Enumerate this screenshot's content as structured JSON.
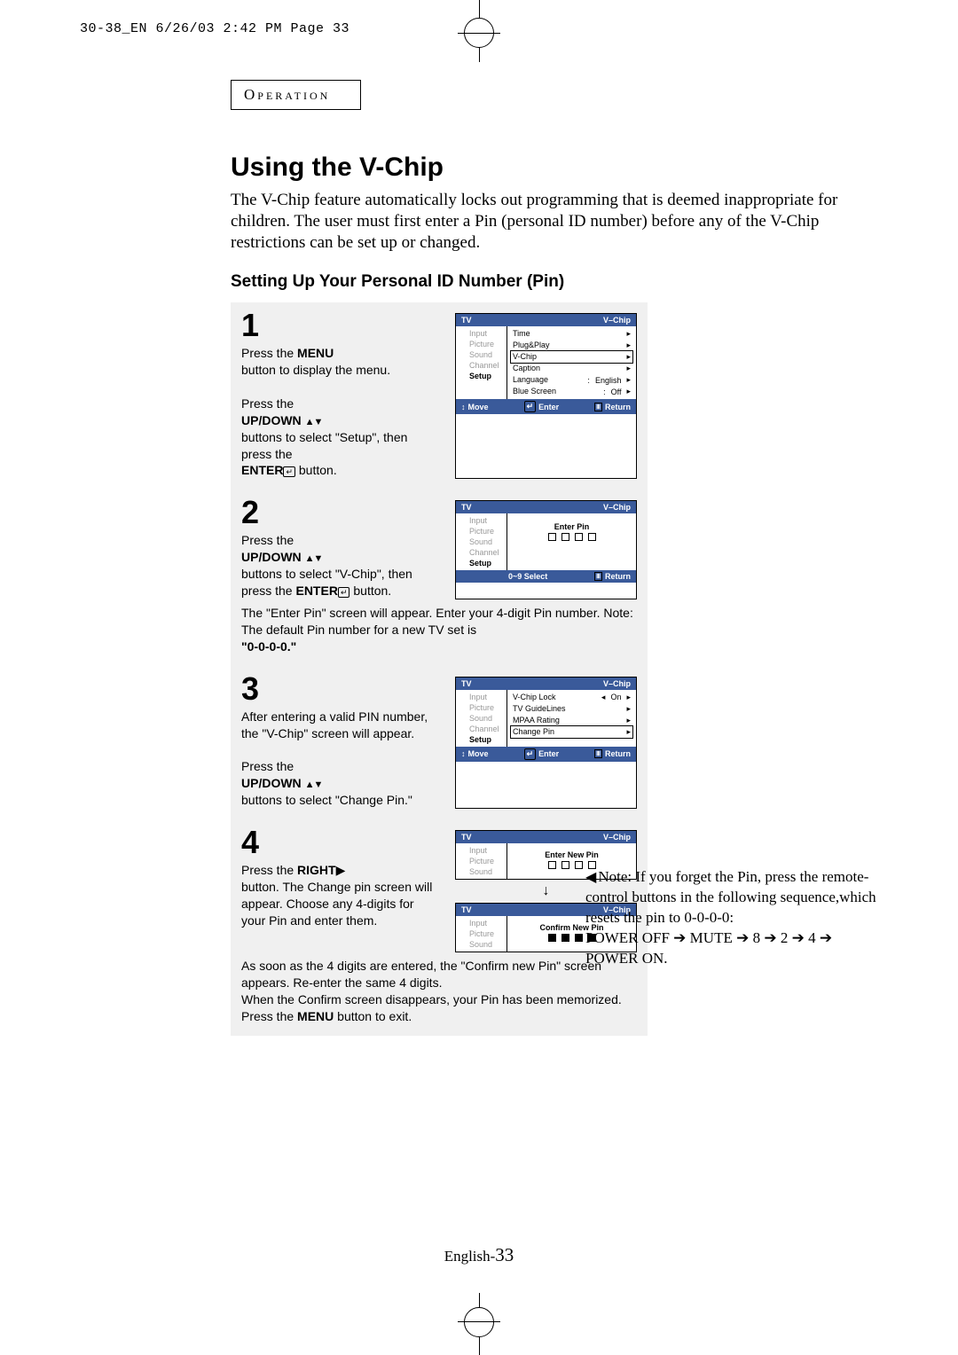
{
  "header_stamp": "30-38_EN  6/26/03 2:42 PM  Page 33",
  "section_label": "Operation",
  "title": "Using the V-Chip",
  "intro": "The V-Chip feature automatically locks out programming that is deemed inappropriate for children. The user must first enter a Pin (personal ID number) before any of the V-Chip restrictions can be set up or changed.",
  "subhead": "Setting Up Your Personal ID Number (Pin)",
  "step1": {
    "num": "1",
    "l1": "Press the ",
    "l1b": "MENU",
    "l2": "button to display the menu.",
    "l3": "Press the",
    "l3b": "UP/DOWN",
    "l4": "buttons to select \"Setup\", then press the",
    "l4b": "ENTER",
    "l5": "  button."
  },
  "step2": {
    "num": "2",
    "l1": "Press the",
    "l1b": "UP/DOWN",
    "l2": "buttons to select \"V-Chip\", then press the ",
    "l2b": "ENTER",
    "l3": "  button.",
    "post": "The \"Enter Pin\" screen will appear. Enter your 4-digit Pin number. Note: The default Pin number for a new TV set is",
    "postb": "\"0-0-0-0.\""
  },
  "step3": {
    "num": "3",
    "l1": "After entering a valid PIN number, the \"V-Chip\" screen will appear.",
    "l2": "Press the",
    "l2b": "UP/DOWN",
    "l3": "buttons to select \"Change Pin.\""
  },
  "step4": {
    "num": "4",
    "l1": "Press the ",
    "l1b": "RIGHT",
    "l2": "button. The Change pin screen will appear. Choose any 4-digits for your Pin and enter them.",
    "post1": "As soon as the 4 digits are entered, the \"Confirm new Pin\" screen appears. Re-enter the same 4 digits.",
    "post2": "When the Confirm screen disappears, your Pin has been memorized.",
    "post3_a": "Press the ",
    "post3_b": "MENU",
    "post3_c": " button to exit."
  },
  "osd_common": {
    "tv": "TV",
    "vchip": "V–Chip",
    "side_input": "Input",
    "side_picture": "Picture",
    "side_sound": "Sound",
    "side_channel": "Channel",
    "side_setup": "Setup",
    "move": "Move",
    "enter": "Enter",
    "return": "Return",
    "select": "0~9 Select"
  },
  "osd1": {
    "time": "Time",
    "plugplay": "Plug&Play",
    "vchip": "V-Chip",
    "caption": "Caption",
    "language": "Language",
    "lang_val": "English",
    "bluescreen": "Blue Screen",
    "blue_val": "Off"
  },
  "osd2": {
    "enter_pin": "Enter Pin"
  },
  "osd3": {
    "lock": "V-Chip Lock",
    "lock_val": "On",
    "guide": "TV GuideLines",
    "mpaa": "MPAA Rating",
    "change": "Change Pin"
  },
  "osd4a": {
    "enter_new": "Enter New Pin"
  },
  "osd4b": {
    "confirm_new": "Confirm New Pin"
  },
  "note": {
    "lead": "Note:  If you forget the Pin, press the remote-control buttons in the following sequence,which resets the pin to 0-0-0-0:",
    "seq": "POWER OFF ➔ MUTE ➔ 8 ➔ 2 ➔ 4 ➔ POWER ON."
  },
  "footer_a": "English-",
  "footer_b": "33"
}
